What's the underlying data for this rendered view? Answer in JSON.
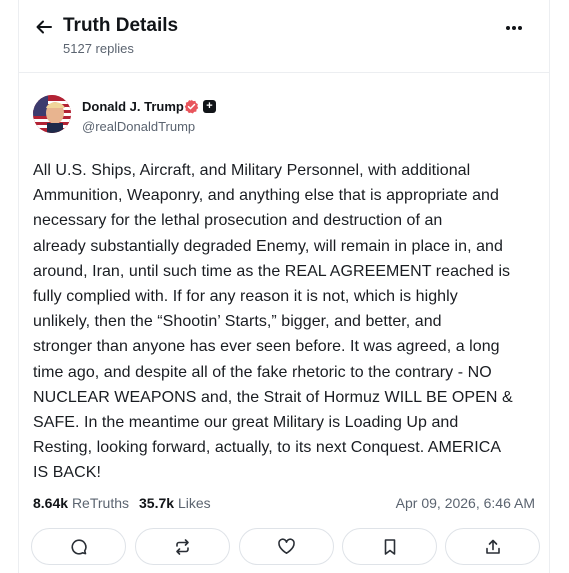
{
  "header": {
    "title": "Truth Details",
    "replies": "5127 replies",
    "back_icon": "arrow-left-icon",
    "more_icon": "more-horizontal-icon"
  },
  "author": {
    "name": "Donald J. Trump",
    "handle": "@realDonaldTrump",
    "verified_color": "#e8555c",
    "plus_badge": "+"
  },
  "post": {
    "lines": [
      "All U.S. Ships, Aircraft, and Military Personnel, with additional",
      "Ammunition, Weaponry, and anything else that is appropriate and",
      "necessary for the lethal prosecution and destruction of an",
      "already substantially degraded Enemy, will remain in place in, and",
      "around, Iran, until such time as the REAL AGREEMENT reached is",
      "fully complied with. If for any reason it is not, which is highly",
      "unlikely, then the “Shootin’ Starts,” bigger, and better, and",
      "stronger than anyone has ever seen before. It was agreed, a long",
      "time ago, and despite all of the fake rhetoric to the contrary - NO",
      "NUCLEAR WEAPONS and, the Strait of Hormuz WILL BE OPEN &",
      "SAFE. In the meantime our great Military is Loading Up and",
      "Resting, looking forward, actually, to its next Conquest. AMERICA",
      "IS BACK!"
    ]
  },
  "stats": {
    "retruths_count": "8.64k",
    "retruths_label": "ReTruths",
    "likes_count": "35.7k",
    "likes_label": "Likes",
    "timestamp": "Apr 09, 2026, 6:46 AM"
  },
  "actions": [
    {
      "icon": "comment-icon"
    },
    {
      "icon": "retruth-icon"
    },
    {
      "icon": "heart-icon"
    },
    {
      "icon": "bookmark-icon"
    },
    {
      "icon": "share-icon"
    }
  ]
}
